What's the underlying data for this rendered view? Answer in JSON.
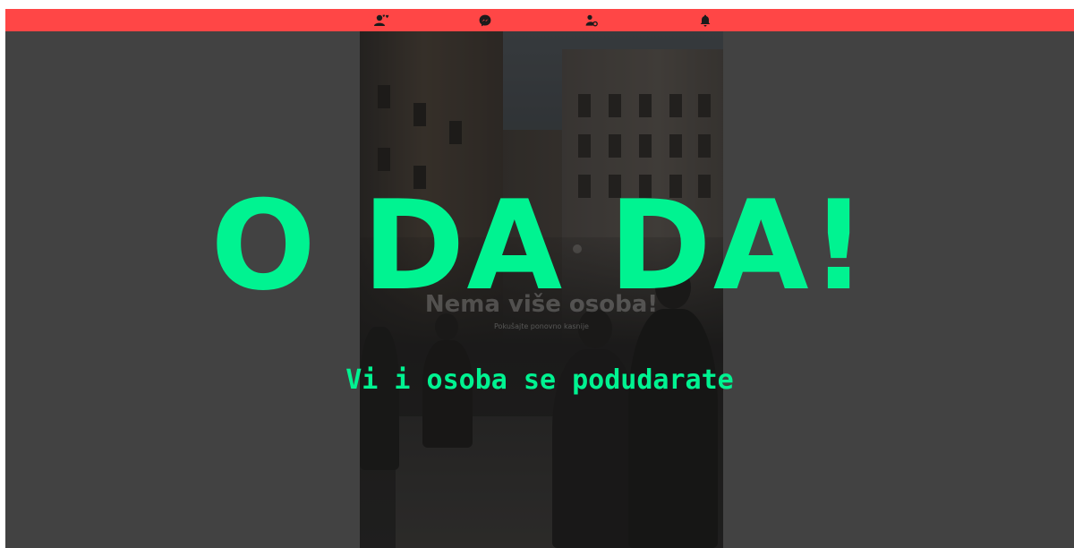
{
  "topbar": {
    "background_color": "#ff4646",
    "icons": [
      {
        "name": "matches-people-icon"
      },
      {
        "name": "messenger-icon"
      },
      {
        "name": "profile-settings-icon"
      },
      {
        "name": "notifications-bell-icon"
      }
    ]
  },
  "card": {
    "title": "Nema više osoba!",
    "subtitle": "Pokušajte ponovno kasnije"
  },
  "match": {
    "title": "O DA DA!",
    "subtitle": "Vi i osoba se podudarate",
    "accent_color": "#00f391"
  }
}
